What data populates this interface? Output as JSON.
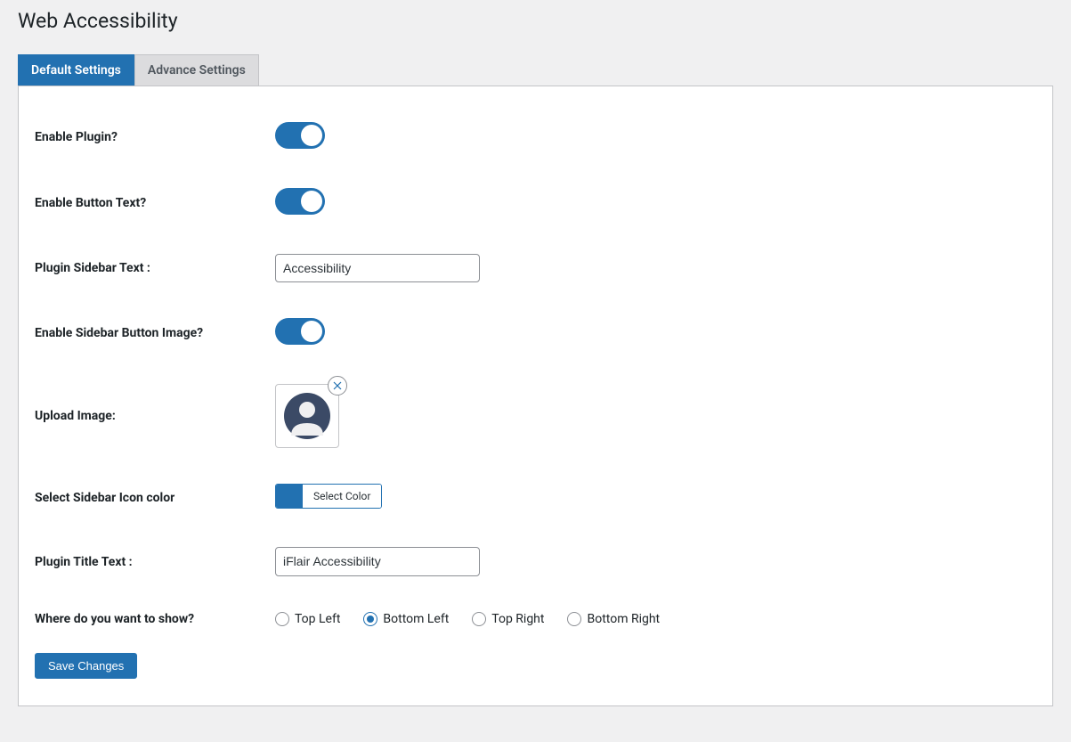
{
  "page": {
    "title": "Web Accessibility"
  },
  "tabs": {
    "default": "Default Settings",
    "advance": "Advance Settings",
    "active": "default"
  },
  "fields": {
    "enable_plugin": {
      "label": "Enable Plugin?",
      "value": true
    },
    "enable_button_text": {
      "label": "Enable Button Text?",
      "value": true
    },
    "sidebar_text": {
      "label": "Plugin Sidebar Text :",
      "value": "Accessibility"
    },
    "enable_sidebar_image": {
      "label": "Enable Sidebar Button Image?",
      "value": true
    },
    "upload_image": {
      "label": "Upload Image:",
      "icon": "avatar-placeholder"
    },
    "icon_color": {
      "label": "Select Sidebar Icon color",
      "button_label": "Select Color",
      "swatch": "#2271b1"
    },
    "title_text": {
      "label": "Plugin Title Text :",
      "value": "iFlair Accessibility"
    },
    "position": {
      "label": "Where do you want to show?",
      "options": [
        {
          "value": "top-left",
          "label": "Top Left"
        },
        {
          "value": "bottom-left",
          "label": "Bottom Left"
        },
        {
          "value": "top-right",
          "label": "Top Right"
        },
        {
          "value": "bottom-right",
          "label": "Bottom Right"
        }
      ],
      "selected": "bottom-left"
    }
  },
  "actions": {
    "save": "Save Changes"
  }
}
